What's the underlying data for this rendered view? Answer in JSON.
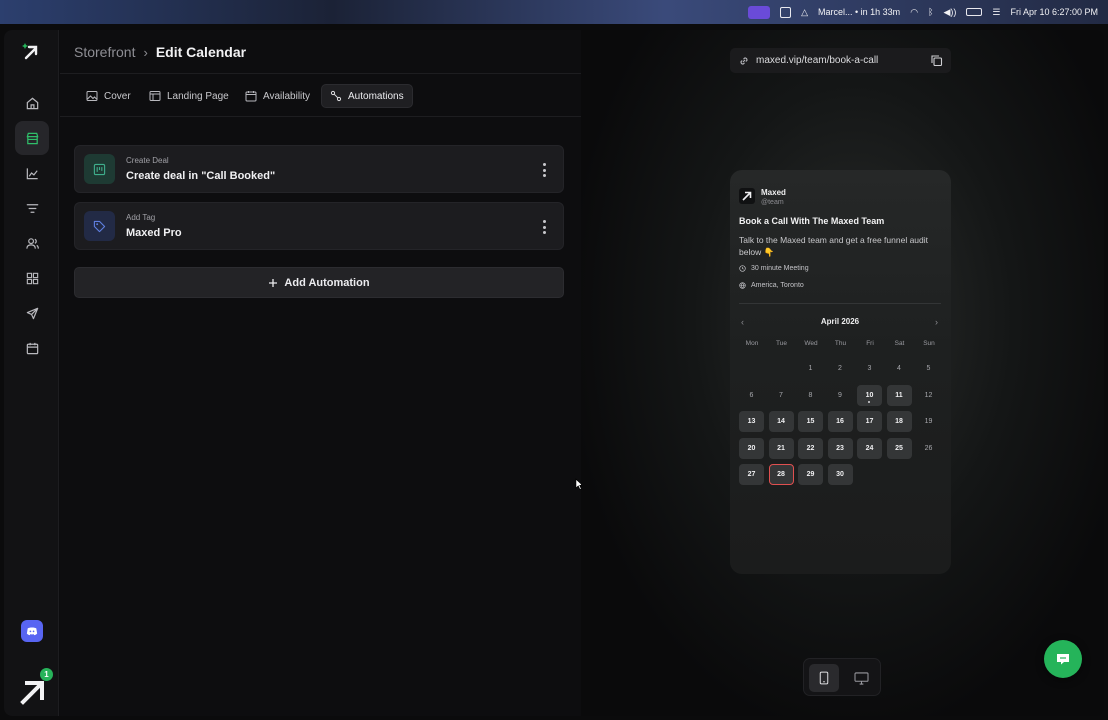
{
  "menubar": {
    "calendar_event": "Marcel... • in 1h 33m",
    "datetime": "Fri Apr 10  6:27:00 PM"
  },
  "header": {
    "breadcrumb_parent": "Storefront",
    "breadcrumb_current": "Edit Calendar"
  },
  "tabs": [
    {
      "label": "Cover",
      "icon": "image-icon"
    },
    {
      "label": "Landing Page",
      "icon": "layout-icon"
    },
    {
      "label": "Availability",
      "icon": "calendar-icon"
    },
    {
      "label": "Automations",
      "icon": "automation-icon",
      "active": true
    }
  ],
  "automations": [
    {
      "subtitle": "Create Deal",
      "title": "Create deal in \"Call Booked\"",
      "icon": "deal-icon",
      "color": "#3fae8c"
    },
    {
      "subtitle": "Add Tag",
      "title": "Maxed Pro",
      "icon": "tag-icon",
      "color": "#5f7fe0"
    }
  ],
  "add_automation_label": "Add Automation",
  "sidebar": {
    "items": [
      "home-icon",
      "storefront-icon",
      "analytics-icon",
      "funnel-icon",
      "contacts-icon",
      "apps-icon",
      "send-icon",
      "calendar-icon"
    ],
    "active": "storefront-icon",
    "notification_count": "1"
  },
  "preview": {
    "url": "maxed.vip/team/book-a-call",
    "profile_name": "Maxed",
    "profile_handle": "@team",
    "title": "Book a Call With The Maxed Team",
    "description": "Talk to the Maxed team and get a free funnel audit below 👇",
    "duration": "30 minute Meeting",
    "timezone": "America, Toronto",
    "calendar": {
      "month": "April 2026",
      "weekdays": [
        "Mon",
        "Tue",
        "Wed",
        "Thu",
        "Fri",
        "Sat",
        "Sun"
      ],
      "first_weekday_index": 2,
      "days_in_month": 30,
      "available": [
        10,
        11,
        13,
        14,
        15,
        16,
        17,
        18,
        20,
        21,
        22,
        23,
        24,
        25,
        27,
        28,
        29,
        30
      ],
      "today": 10,
      "selected": 28
    },
    "device": "mobile"
  },
  "colors": {
    "accent": "#25b45a",
    "selected_border": "#e05050",
    "discord": "#5865f2"
  }
}
